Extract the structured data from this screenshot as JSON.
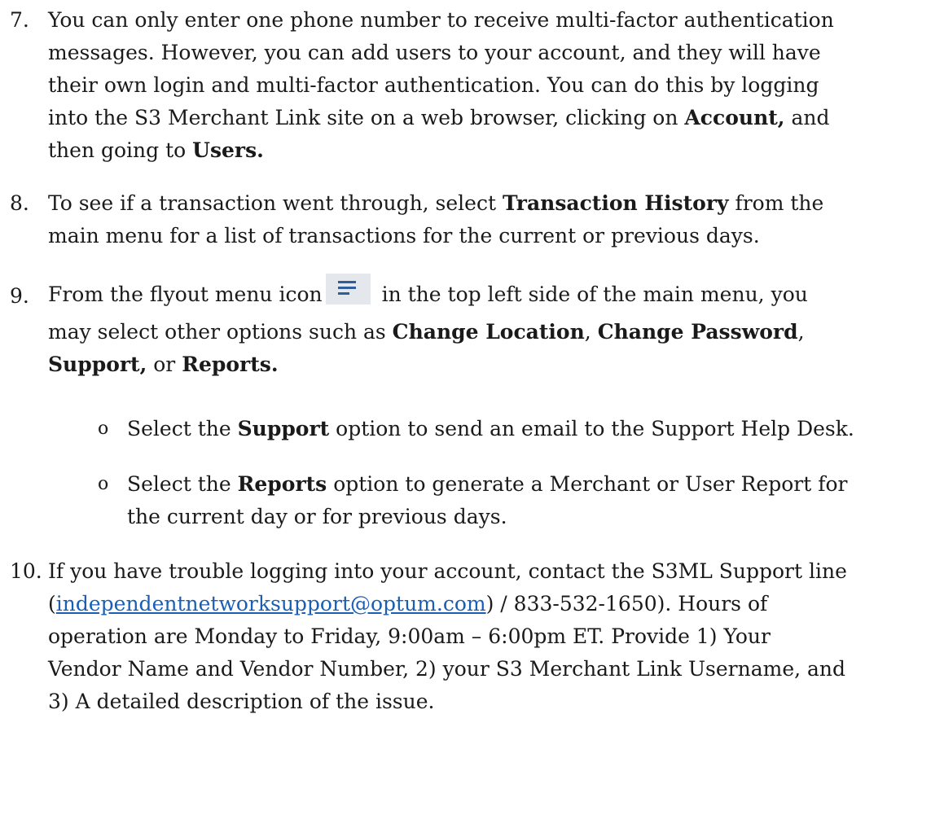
{
  "item7": {
    "number": "7.",
    "l1": "You can only enter one phone number to receive multi-factor authentication",
    "l2": "messages. However, you can add users to your account, and they will have",
    "l3": "their own login and multi-factor authentication. You can do this by logging",
    "l4a": "into the S3 Merchant Link site on a web browser, clicking on ",
    "l4b": "Account,",
    "l4c": " and",
    "l5a": "then going to ",
    "l5b": "Users."
  },
  "item8": {
    "number": "8.",
    "l1a": "To see if a transaction went through, select ",
    "l1b": "Transaction History",
    "l1c": " from the",
    "l2": "main menu for a list of transactions for the current or previous days."
  },
  "item9": {
    "number": "9.",
    "icon": "flyout-menu-icon",
    "l1a": "From the flyout menu icon",
    "l1b": " in the top left side of the main menu, you",
    "l2a": "may select other options such as ",
    "l2b": "Change Location",
    "l2c": ", ",
    "l2d": "Change Password",
    "l2e": ",",
    "l3a": "Support,",
    "l3b": " or ",
    "l3c": "Reports.",
    "bullets": [
      {
        "marker": "o",
        "l1a": "Select the ",
        "l1b": "Support",
        "l1c": " option to send an email to the Support Help Desk."
      },
      {
        "marker": "o",
        "l1a": "Select the ",
        "l1b": "Reports",
        "l1c": " option to generate a Merchant or User Report for",
        "l2": "the current day or for previous days."
      }
    ]
  },
  "item10": {
    "number": "10.",
    "l1": "If you have trouble logging into your account, contact the S3ML Support line",
    "l2a": "(",
    "l2b": "independentnetworksupport@optum.com",
    "l2c": ") / 833-532-1650). Hours of",
    "l3": "operation are Monday to Friday, 9:00am – 6:00pm ET.  Provide 1) Your",
    "l4": "Vendor Name and Vendor Number, 2) your S3 Merchant Link Username, and",
    "l5": "3) A detailed description of the issue."
  },
  "colors": {
    "text": "#1a1a1a",
    "link": "#1a5fb4",
    "icon_bg": "#e4e7eb",
    "icon_lines": "#2f5f9a"
  }
}
